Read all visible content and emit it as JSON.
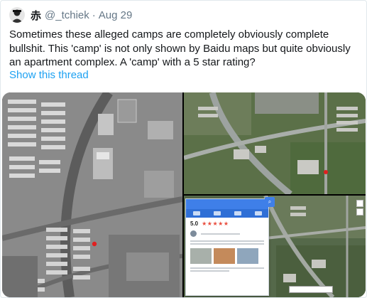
{
  "tweet": {
    "display_name": "赤",
    "handle": "@_tchiek",
    "separator": "·",
    "date": "Aug 29",
    "text": "Sometimes these alleged camps are completely obviously complete bullshit. This 'camp' is not only shown by Baidu maps but quite obviously an apartment complex. A 'camp' with a 5 star rating?",
    "thread_link": "Show this thread"
  },
  "media": {
    "rating_score": "5.0",
    "rating_stars": "★★★★★"
  },
  "colors": {
    "link": "#1da1f2",
    "secondary_text": "#657786",
    "baidu_blue": "#3f7fe8",
    "star_red": "#e94c3d"
  }
}
